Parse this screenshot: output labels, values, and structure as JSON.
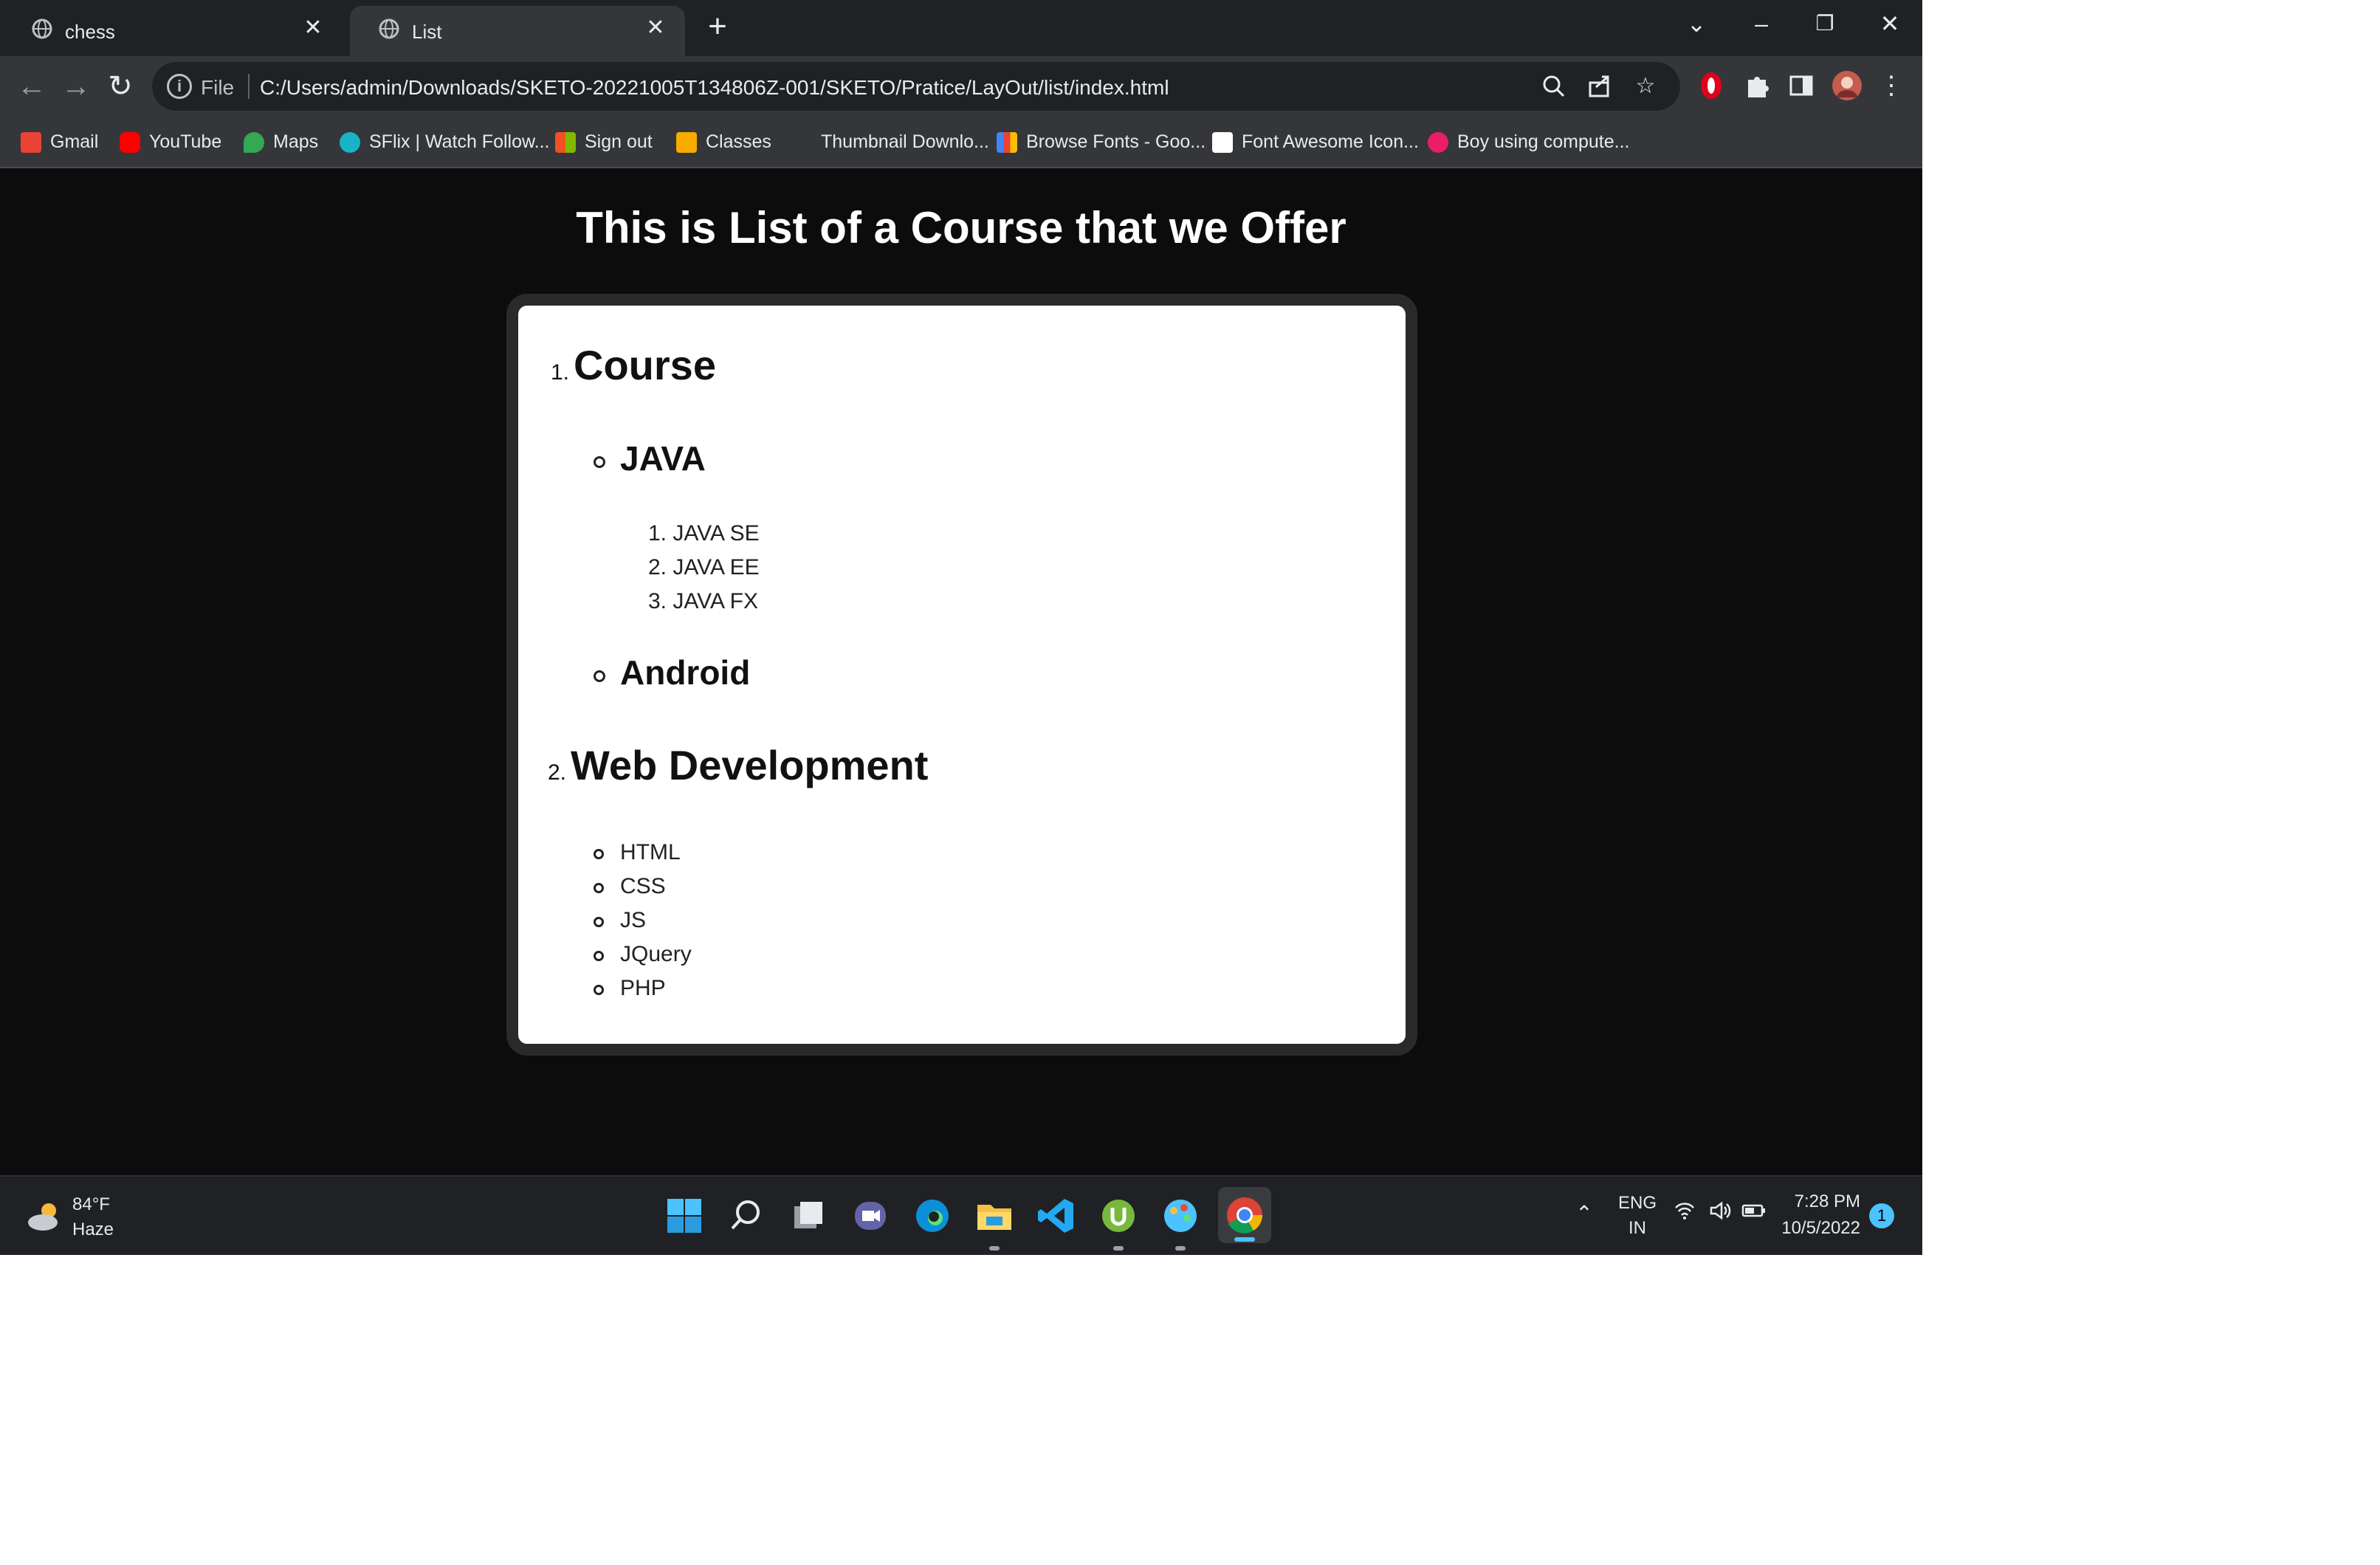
{
  "browser": {
    "tabs": [
      {
        "label": "chess",
        "active": false
      },
      {
        "label": "List",
        "active": true
      }
    ],
    "new_tab": "+",
    "window_controls": {
      "list": "⌄",
      "minimize": "–",
      "restore": "❐",
      "close": "✕"
    },
    "address": {
      "scheme_label": "File",
      "url": "C:/Users/admin/Downloads/SKETO-20221005T134806Z-001/SKETO/Pratice/LayOut/list/index.html"
    },
    "bookmarks": [
      {
        "label": "Gmail",
        "color": "#ea4335"
      },
      {
        "label": "YouTube",
        "color": "#ff0000"
      },
      {
        "label": "Maps",
        "color": "#34a853"
      },
      {
        "label": "SFlix | Watch Follow...",
        "color": "#19b3c8"
      },
      {
        "label": "Sign out",
        "color": "#f25022"
      },
      {
        "label": "Classes",
        "color": "#f9ab00"
      },
      {
        "label": "Thumbnail Downlo...",
        "color": "#35363a"
      },
      {
        "label": "Browse Fonts - Goo...",
        "color": "#4285f4"
      },
      {
        "label": "Font Awesome Icon...",
        "color": "#ffffff"
      },
      {
        "label": "Boy using compute...",
        "color": "#e91e63"
      }
    ]
  },
  "page": {
    "title": "This is List of a Course that we Offer",
    "courses": [
      {
        "num": "1.",
        "label": "Course"
      },
      {
        "num": "2.",
        "label": "Web Development"
      }
    ],
    "course_subitems": [
      "JAVA",
      "Android"
    ],
    "java_items": [
      {
        "num": "1.",
        "label": "JAVA SE"
      },
      {
        "num": "2.",
        "label": "JAVA EE"
      },
      {
        "num": "3.",
        "label": "JAVA FX"
      }
    ],
    "webdev_items": [
      "HTML",
      "CSS",
      "JS",
      "JQuery",
      "PHP"
    ]
  },
  "taskbar": {
    "weather": {
      "temp": "84°F",
      "condition": "Haze"
    },
    "language": {
      "line1": "ENG",
      "line2": "IN"
    },
    "time": "7:28 PM",
    "date": "10/5/2022",
    "notification_count": "1"
  }
}
